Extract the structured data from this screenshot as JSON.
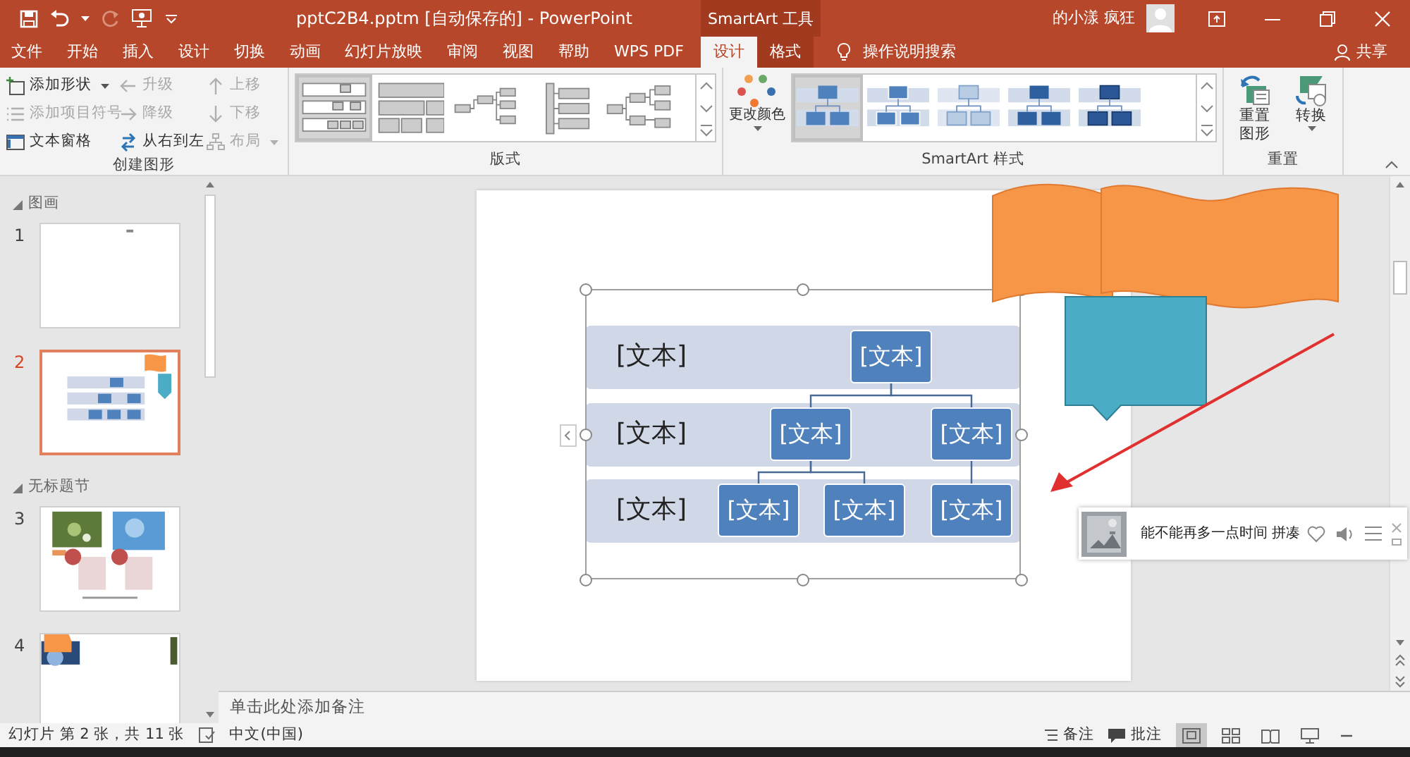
{
  "title_bar": {
    "title": "pptC2B4.pptm [自动保存的] - PowerPoint",
    "context_label": "SmartArt 工具",
    "user_name": "的小漾 疯狂"
  },
  "tabs": [
    {
      "label": "文件",
      "selected": false,
      "kind": "normal"
    },
    {
      "label": "开始",
      "selected": false,
      "kind": "normal"
    },
    {
      "label": "插入",
      "selected": false,
      "kind": "normal"
    },
    {
      "label": "设计",
      "selected": false,
      "kind": "normal"
    },
    {
      "label": "切换",
      "selected": false,
      "kind": "normal"
    },
    {
      "label": "动画",
      "selected": false,
      "kind": "normal"
    },
    {
      "label": "幻灯片放映",
      "selected": false,
      "kind": "normal"
    },
    {
      "label": "审阅",
      "selected": false,
      "kind": "normal"
    },
    {
      "label": "视图",
      "selected": false,
      "kind": "normal"
    },
    {
      "label": "帮助",
      "selected": false,
      "kind": "normal"
    },
    {
      "label": "WPS PDF",
      "selected": false,
      "kind": "normal"
    },
    {
      "label": "设计",
      "selected": true,
      "kind": "context"
    },
    {
      "label": "格式",
      "selected": false,
      "kind": "context"
    }
  ],
  "tell_me": "操作说明搜索",
  "share": "共享",
  "ribbon": {
    "create_graphic": {
      "title": "创建图形",
      "items": [
        {
          "label": "添加形状",
          "disabled": false,
          "dropdown": true,
          "kind": "add-shape"
        },
        {
          "label": "升级",
          "disabled": true,
          "kind": "promote"
        },
        {
          "label": "上移",
          "disabled": true,
          "kind": "up"
        },
        {
          "label": "添加项目符号",
          "disabled": true,
          "kind": "bullet"
        },
        {
          "label": "降级",
          "disabled": true,
          "kind": "demote"
        },
        {
          "label": "下移",
          "disabled": true,
          "kind": "down"
        },
        {
          "label": "文本窗格",
          "disabled": false,
          "kind": "text-pane"
        },
        {
          "label": "从右到左",
          "disabled": false,
          "kind": "rtl"
        },
        {
          "label": "布局",
          "disabled": true,
          "dropdown": true,
          "kind": "layout"
        }
      ]
    },
    "layouts": {
      "title": "版式",
      "items": [
        {
          "kind": "labeled-hierarchy",
          "selected": true
        },
        {
          "kind": "table-hierarchy",
          "selected": false
        },
        {
          "kind": "horizontal-hierarchy",
          "selected": false
        },
        {
          "kind": "bracket-list",
          "selected": false
        },
        {
          "kind": "horizontal-tree",
          "selected": false
        }
      ]
    },
    "change_colors": "更改颜色",
    "styles": {
      "title": "SmartArt 样式",
      "items": [
        {
          "kind": "simple",
          "selected": true
        },
        {
          "kind": "outline",
          "selected": false
        },
        {
          "kind": "light",
          "selected": false
        },
        {
          "kind": "intense",
          "selected": false
        },
        {
          "kind": "bevel",
          "selected": false
        }
      ]
    },
    "reset": {
      "title": "重置",
      "buttons": [
        {
          "label": "重置图形",
          "kind": "reset"
        },
        {
          "label": "转换",
          "kind": "convert",
          "dropdown": true
        }
      ]
    }
  },
  "sidebar": {
    "sections": [
      {
        "title": "图画",
        "expanded": true,
        "slides": [
          {
            "number": "1",
            "selected": false,
            "kind": "title"
          },
          {
            "number": "2",
            "selected": true,
            "kind": "smartart"
          }
        ]
      },
      {
        "title": "无标题节",
        "expanded": true,
        "slides": [
          {
            "number": "3",
            "selected": false,
            "kind": "photos"
          },
          {
            "number": "4",
            "selected": false,
            "kind": "banner"
          }
        ]
      }
    ]
  },
  "slide": {
    "smartart": {
      "row_labels": [
        "[文本]",
        "[文本]",
        "[文本]"
      ],
      "tree": {
        "text": "[文本]",
        "children": [
          {
            "text": "[文本]",
            "children": [
              {
                "text": "[文本]"
              },
              {
                "text": "[文本]"
              }
            ]
          },
          {
            "text": "[文本]",
            "children": [
              {
                "text": "[文本]"
              }
            ]
          }
        ]
      }
    }
  },
  "notes_placeholder": "单击此处添加备注",
  "music_popup": {
    "song": "能不能再多一点时间 拼凑"
  },
  "status_bar": {
    "slide_info": "幻灯片 第 2 张，共 11 张",
    "language": "中文(中国)",
    "notes": "备注",
    "comments": "批注",
    "views": [
      {
        "kind": "normal",
        "selected": true
      },
      {
        "kind": "sorter",
        "selected": false
      },
      {
        "kind": "reading",
        "selected": false
      },
      {
        "kind": "slideshow",
        "selected": false
      }
    ]
  }
}
